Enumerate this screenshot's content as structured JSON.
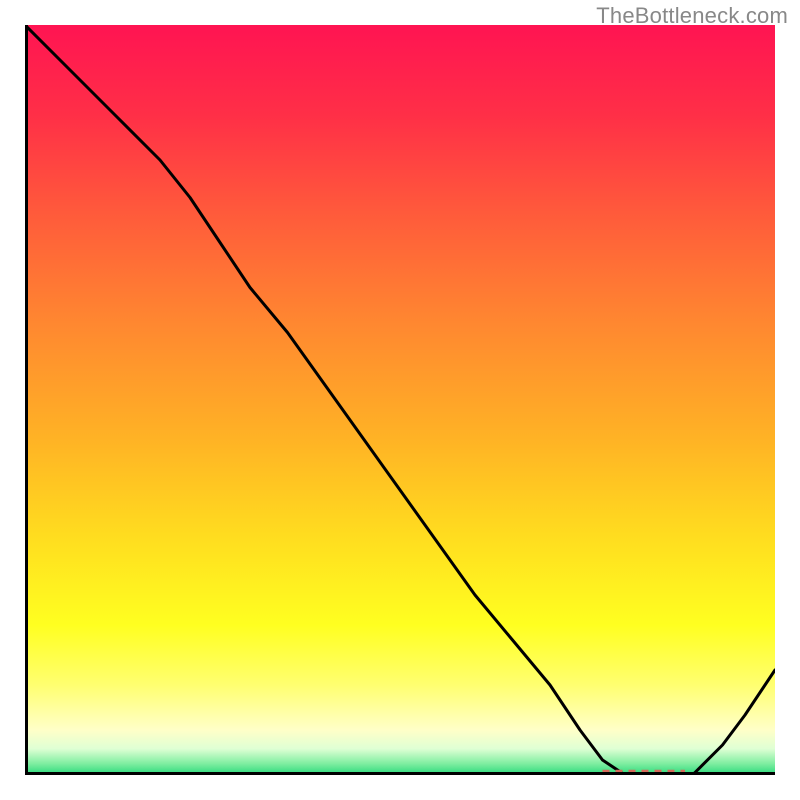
{
  "attribution": "TheBottleneck.com",
  "chart_data": {
    "type": "line",
    "x": [
      0.0,
      0.06,
      0.12,
      0.18,
      0.22,
      0.26,
      0.3,
      0.35,
      0.4,
      0.45,
      0.5,
      0.55,
      0.6,
      0.65,
      0.7,
      0.74,
      0.77,
      0.8,
      0.83,
      0.86,
      0.89,
      0.93,
      0.96,
      1.0
    ],
    "values": [
      1.0,
      0.94,
      0.88,
      0.82,
      0.77,
      0.71,
      0.65,
      0.59,
      0.52,
      0.45,
      0.38,
      0.31,
      0.24,
      0.18,
      0.12,
      0.06,
      0.02,
      0.0,
      0.0,
      0.0,
      0.0,
      0.04,
      0.08,
      0.14
    ],
    "ylim": [
      0,
      1
    ],
    "xlim": [
      0,
      1
    ],
    "title": "",
    "xlabel": "",
    "ylabel": "",
    "gradient_stops": [
      {
        "offset": 0.0,
        "color": "#ff1452"
      },
      {
        "offset": 0.12,
        "color": "#ff2f47"
      },
      {
        "offset": 0.25,
        "color": "#ff5a3b"
      },
      {
        "offset": 0.4,
        "color": "#ff8830"
      },
      {
        "offset": 0.55,
        "color": "#ffb225"
      },
      {
        "offset": 0.68,
        "color": "#ffdc1f"
      },
      {
        "offset": 0.8,
        "color": "#ffff20"
      },
      {
        "offset": 0.88,
        "color": "#ffff70"
      },
      {
        "offset": 0.94,
        "color": "#ffffc8"
      },
      {
        "offset": 0.965,
        "color": "#dfffd4"
      },
      {
        "offset": 0.985,
        "color": "#7eeea0"
      },
      {
        "offset": 1.0,
        "color": "#28d87a"
      }
    ],
    "dashed_marker": {
      "x_start": 0.77,
      "x_end": 0.88,
      "y": 0.003,
      "color": "#d66a5a"
    }
  }
}
